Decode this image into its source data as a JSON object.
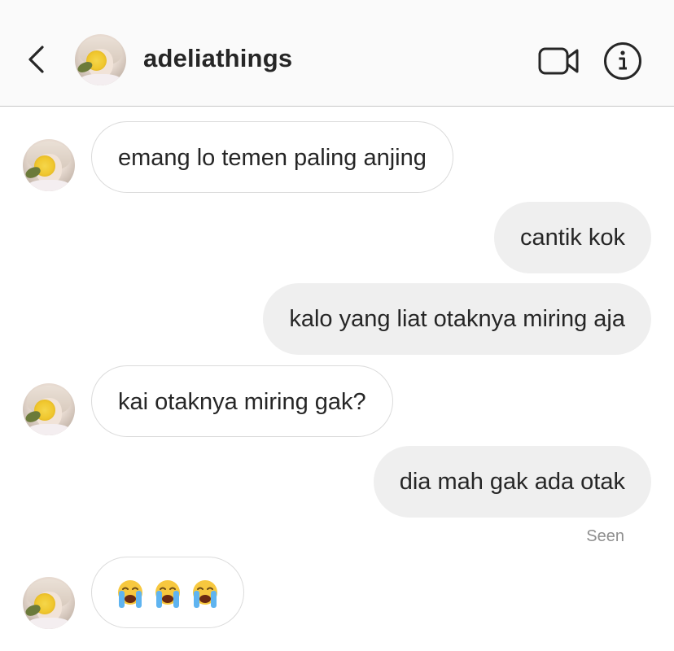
{
  "header": {
    "username": "adeliathings"
  },
  "icons": {
    "back": "chevron-left-icon",
    "video": "video-camera-icon",
    "info": "info-circle-icon"
  },
  "messages": [
    {
      "direction": "incoming",
      "text": "emang lo temen paling anjing"
    },
    {
      "direction": "outgoing",
      "text": "cantik kok"
    },
    {
      "direction": "outgoing",
      "text": "kalo yang liat otaknya miring aja"
    },
    {
      "direction": "incoming",
      "text": "kai otaknya miring gak?"
    },
    {
      "direction": "outgoing",
      "text": "dia mah gak ada otak"
    },
    {
      "direction": "incoming",
      "text": "😭😭😭"
    }
  ],
  "seen_label": "Seen"
}
